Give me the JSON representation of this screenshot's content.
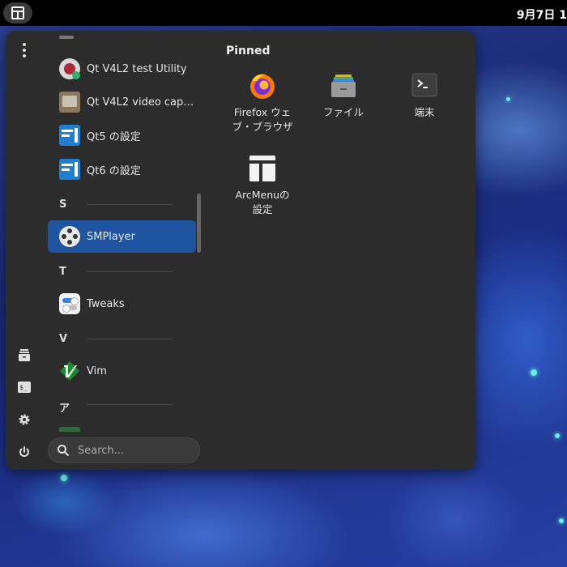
{
  "topbar": {
    "clock": "9月7日 1",
    "arcmenu_icon": "arcmenu-icon"
  },
  "sidebar": {
    "menu_icon": "kebab-menu-icon",
    "shortcuts": [
      {
        "name": "files-shortcut",
        "icon": "files-icon"
      },
      {
        "name": "terminal-shortcut",
        "icon": "terminal-icon"
      },
      {
        "name": "settings-shortcut",
        "icon": "gear-icon"
      },
      {
        "name": "power-button",
        "icon": "power-icon"
      }
    ]
  },
  "apps": {
    "items": [
      {
        "label": "Qt V4L2 test Utility",
        "icon": "qv4l2-icon"
      },
      {
        "label": "Qt V4L2 video capt...",
        "icon": "qvidcap-icon"
      },
      {
        "label": "Qt5 の設定",
        "icon": "qt5ct-icon"
      },
      {
        "label": "Qt6 の設定",
        "icon": "qt6ct-icon"
      },
      {
        "label": "SMPlayer",
        "icon": "smplayer-icon",
        "selected": true
      },
      {
        "label": "Tweaks",
        "icon": "tweaks-icon"
      },
      {
        "label": "Vim",
        "icon": "vim-icon"
      }
    ],
    "sections": [
      "S",
      "T",
      "V",
      "ア"
    ]
  },
  "search": {
    "placeholder": "Search..."
  },
  "pinned": {
    "title": "Pinned",
    "items": [
      {
        "label": "Firefox ウェブ・ブラウザ",
        "line1": "Firefox ウェ",
        "line2": "ブ・ブラウザ",
        "icon": "firefox-icon"
      },
      {
        "label": "ファイル",
        "icon": "files-icon"
      },
      {
        "label": "端末",
        "icon": "terminal-icon"
      },
      {
        "label": "ArcMenuの設定",
        "line1": "ArcMenuの",
        "line2": "設定",
        "icon": "arcmenu-settings-icon"
      }
    ]
  },
  "colors": {
    "panel": "#2c2c2c",
    "selection": "#1e54a0",
    "topbar": "#000000"
  }
}
